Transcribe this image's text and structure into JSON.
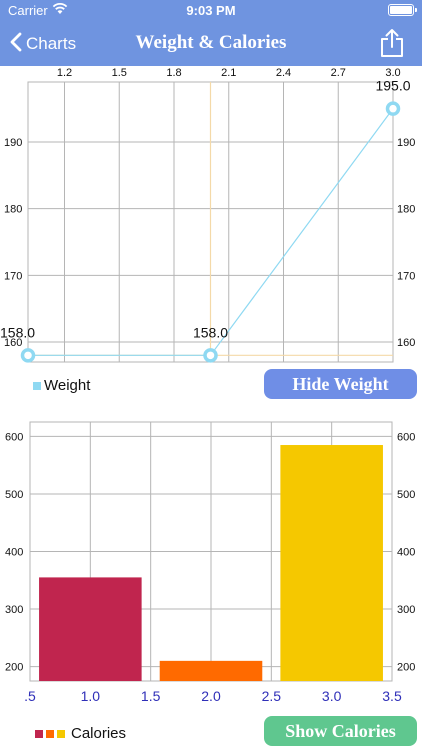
{
  "status": {
    "carrier": "Carrier",
    "time": "9:03 PM"
  },
  "nav": {
    "back_label": "Charts",
    "title": "Weight & Calories"
  },
  "weight_section": {
    "button_label": "Hide Weight",
    "legend_label": "Weight",
    "legend_color": "#8fd9f2"
  },
  "calories_section": {
    "button_label": "Show Calories",
    "legend_label": "Calories",
    "legend_colors": [
      "#c0254e",
      "#ff6a00",
      "#f5c800"
    ]
  },
  "chart_data": [
    {
      "type": "line",
      "x": [
        1.0,
        2.0,
        3.0
      ],
      "series": [
        {
          "name": "Weight",
          "values": [
            158.0,
            158.0,
            195.0
          ],
          "color": "#8fd9f2"
        }
      ],
      "data_labels": [
        "158.0",
        "158.0",
        "195.0"
      ],
      "x_ticks": [
        "1.2",
        "1.5",
        "1.8",
        "2.1",
        "2.4",
        "2.7",
        "3.0"
      ],
      "y_ticks_left": [
        "160",
        "170",
        "180",
        "190"
      ],
      "y_ticks_right": [
        "160",
        "170",
        "180",
        "190"
      ],
      "xlim": [
        1.0,
        3.0
      ],
      "ylim": [
        157,
        199
      ],
      "grid": true,
      "legend": "bottom-left",
      "crosshair": {
        "x": 2.0,
        "y": 158.0,
        "color": "#f4d9a8"
      }
    },
    {
      "type": "bar",
      "categories": [
        "1.0",
        "2.0",
        "3.0"
      ],
      "values": [
        355,
        210,
        585
      ],
      "colors": [
        "#c0254e",
        "#ff6a00",
        "#f5c800"
      ],
      "x_ticks": [
        ".5",
        "1.0",
        "1.5",
        "2.0",
        "2.5",
        "3.0",
        "3.5"
      ],
      "y_ticks_left": [
        "200",
        "300",
        "400",
        "500",
        "600"
      ],
      "y_ticks_right": [
        "200",
        "300",
        "400",
        "500",
        "600"
      ],
      "xlim": [
        0.5,
        3.5
      ],
      "ylim": [
        175,
        625
      ],
      "series": [
        {
          "name": "Calories",
          "values": [
            355,
            210,
            585
          ]
        }
      ],
      "grid": true,
      "legend": "bottom-left"
    }
  ]
}
